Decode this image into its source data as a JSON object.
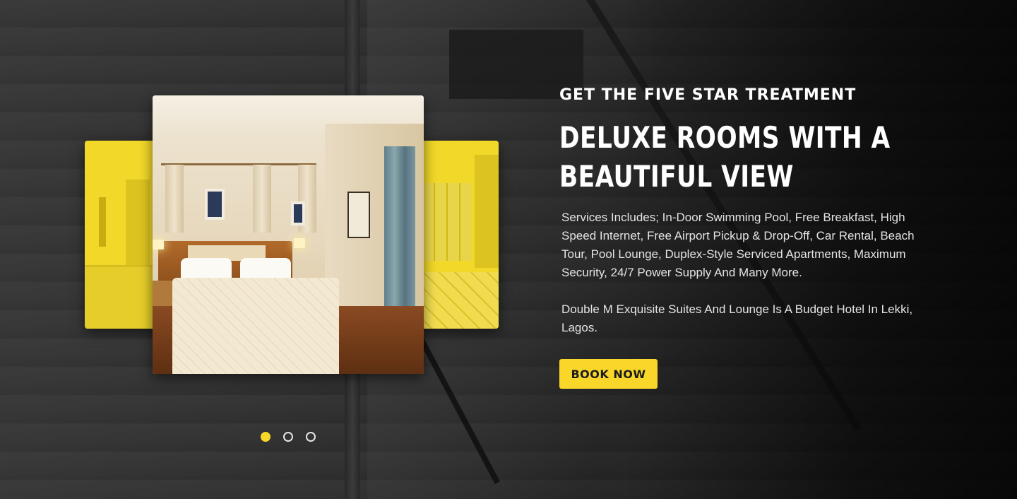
{
  "hero": {
    "eyebrow": "GET THE FIVE STAR TREATMENT",
    "headline": "DELUXE ROOMS WITH A BEAUTIFUL VIEW",
    "description_1": "Services Includes; In-Door Swimming Pool, Free Breakfast, High Speed Internet, Free Airport Pickup & Drop-Off, Car Rental, Beach Tour, Pool Lounge, Duplex-Style Serviced Apartments, Maximum Security, 24/7 Power Supply And Many More.",
    "description_2": "Double M Exquisite Suites And Lounge Is A Budget Hotel In Lekki, Lagos.",
    "cta_label": "BOOK NOW"
  },
  "slider": {
    "slide_count": 3,
    "active_index": 0
  },
  "colors": {
    "accent": "#f8d72a",
    "background": "#1c1c1c",
    "text": "#ffffff",
    "muted_text": "#e4e4e4"
  }
}
